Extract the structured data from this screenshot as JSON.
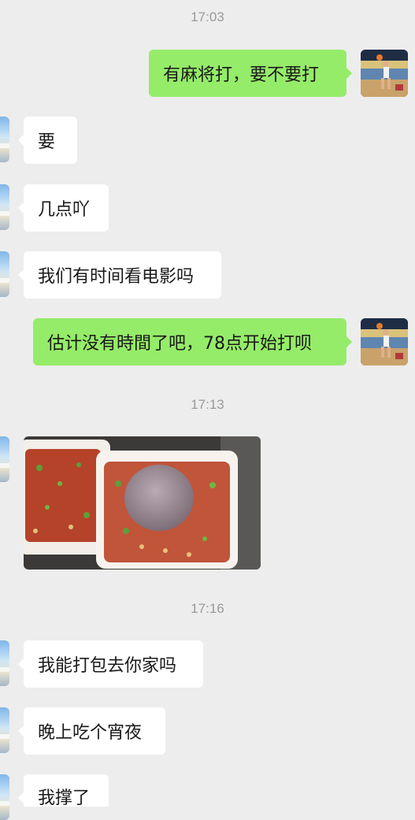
{
  "chat": {
    "timestamps": [
      "17:03",
      "17:13",
      "17:16"
    ],
    "messages": [
      {
        "from": "me",
        "text": "有麻将打，要不要打"
      },
      {
        "from": "friend",
        "text": "要"
      },
      {
        "from": "friend",
        "text": "几点吖"
      },
      {
        "from": "friend",
        "text": "我们有时间看电影吗"
      },
      {
        "from": "me",
        "text": "估计没有時間了吧，78点开始打呗"
      },
      {
        "from": "friend",
        "type": "image",
        "image": "food-photo"
      },
      {
        "from": "friend",
        "text": "我能打包去你家吗"
      },
      {
        "from": "friend",
        "text": "晚上吃个宵夜"
      },
      {
        "from": "friend",
        "text": "我撑了"
      }
    ]
  },
  "colors": {
    "background": "#ededed",
    "outgoing_bubble": "#95ec69",
    "incoming_bubble": "#ffffff",
    "timestamp_text": "#9a9a9a"
  },
  "icons": {
    "friend_avatar": "beach-avatar",
    "my_avatar": "basketball-player-avatar"
  }
}
